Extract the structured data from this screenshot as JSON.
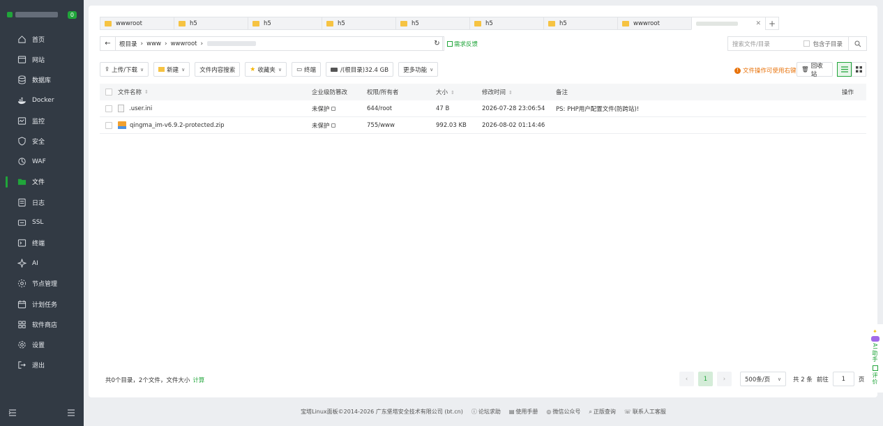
{
  "sidebar": {
    "badge": "0",
    "items": [
      {
        "label": "首页",
        "icon": "home-icon"
      },
      {
        "label": "网站",
        "icon": "globe-icon"
      },
      {
        "label": "数据库",
        "icon": "database-icon"
      },
      {
        "label": "Docker",
        "icon": "docker-icon"
      },
      {
        "label": "监控",
        "icon": "monitor-icon"
      },
      {
        "label": "安全",
        "icon": "shield-icon"
      },
      {
        "label": "WAF",
        "icon": "waf-icon"
      },
      {
        "label": "文件",
        "icon": "folder-icon"
      },
      {
        "label": "日志",
        "icon": "log-icon"
      },
      {
        "label": "SSL",
        "icon": "ssl-icon"
      },
      {
        "label": "终端",
        "icon": "terminal-icon"
      },
      {
        "label": "AI",
        "icon": "ai-icon"
      },
      {
        "label": "节点管理",
        "icon": "node-icon"
      },
      {
        "label": "计划任务",
        "icon": "calendar-icon"
      },
      {
        "label": "软件商店",
        "icon": "store-icon"
      },
      {
        "label": "设置",
        "icon": "gear-icon"
      },
      {
        "label": "退出",
        "icon": "logout-icon"
      }
    ],
    "active": "文件"
  },
  "tabs": [
    "wwwroot",
    "h5",
    "h5",
    "h5",
    "h5",
    "h5",
    "h5",
    "wwwroot"
  ],
  "path": {
    "root": "根目录",
    "segs": [
      "www",
      "wwwroot"
    ],
    "feedback": "需求反馈"
  },
  "search": {
    "placeholder": "搜索文件/目录",
    "sub": "包含子目录"
  },
  "toolbar": {
    "upload": "上传/下载",
    "new": "新建",
    "content_search": "文件内容搜索",
    "favorites": "收藏夹",
    "terminal": "终端",
    "disk": "/(根目录)32.4 GB",
    "more": "更多功能",
    "warn": "文件操作可使用右键",
    "recycle": "回收站"
  },
  "table": {
    "headers": {
      "name": "文件名称",
      "protect": "企业级防篡改",
      "perm": "权限/所有者",
      "size": "大小",
      "mtime": "修改时间",
      "note": "备注",
      "ops": "操作"
    },
    "rows": [
      {
        "name": ".user.ini",
        "protect": "未保护",
        "perm": "644/root",
        "size": "47 B",
        "mtime": "2026-07-28 23:06:54",
        "note": "PS: PHP用户配置文件(防跨站)!"
      },
      {
        "name": "qingma_im-v6.9.2-protected.zip",
        "protect": "未保护",
        "perm": "755/www",
        "size": "992.03 KB",
        "mtime": "2026-08-02 01:14:46",
        "note": ""
      }
    ]
  },
  "summary": {
    "text": "共0个目录，2个文件，文件大小",
    "calc": "计算"
  },
  "pager": {
    "page": "1",
    "size": "500条/页",
    "total": "共 2 条",
    "goto": "前往",
    "goto_value": "1",
    "unit": "页"
  },
  "footer": {
    "copyright": "宝塔Linux面板©2014-2026 广东堡塔安全技术有限公司 (bt.cn)",
    "links": [
      "论坛求助",
      "使用手册",
      "微信公众号",
      "正版查询",
      "联系人工客服"
    ]
  },
  "ai": {
    "assistant": "AI助手",
    "rate": "评价"
  }
}
